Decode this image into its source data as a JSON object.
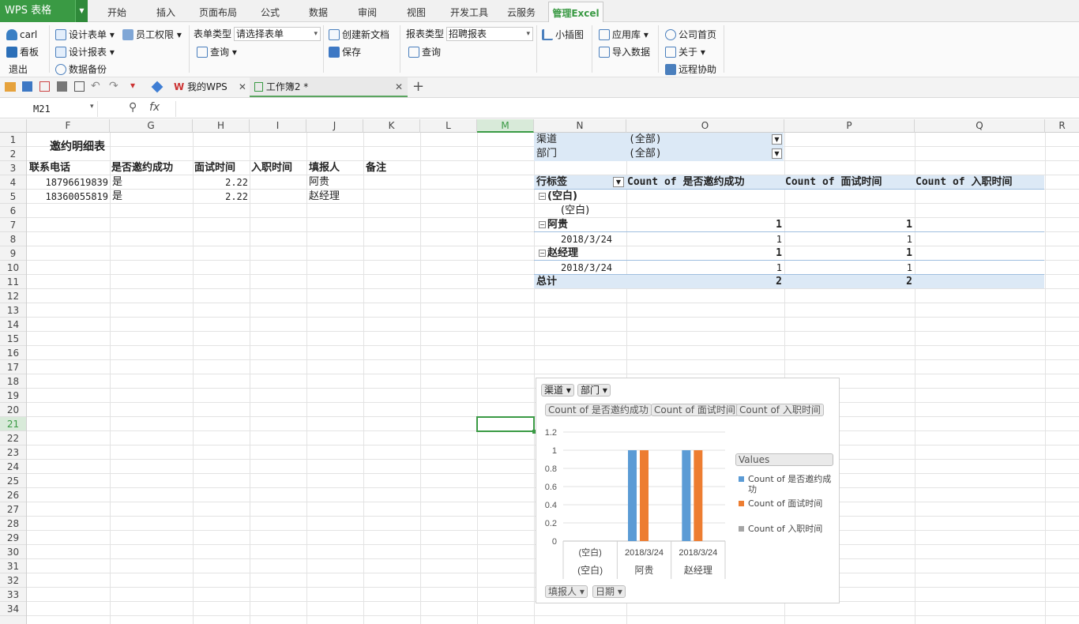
{
  "app": {
    "logo": "WPS 表格",
    "tabs": [
      "开始",
      "插入",
      "页面布局",
      "公式",
      "数据",
      "审阅",
      "视图",
      "开发工具",
      "云服务",
      "管理Excel"
    ]
  },
  "ribbon": {
    "user": "carl",
    "board": "看板",
    "logout": "退出",
    "design_form": "设计表单",
    "staff_perm": "员工权限",
    "form_type_label": "表单类型",
    "form_type_value": "请选择表单",
    "query1": "查询",
    "new_doc": "创建新文档",
    "save": "保存",
    "design_report": "设计报表",
    "backup": "数据备份",
    "report_type_label": "报表类型",
    "report_type_value": "招聘报表",
    "query2": "查询",
    "mini_chart": "小插图",
    "app_store": "应用库",
    "import_data": "导入数据",
    "home": "公司首页",
    "about": "关于",
    "remote": "远程协助"
  },
  "doctabs": {
    "mywps": "我的WPS",
    "workbook": "工作簿2 *"
  },
  "formula": {
    "name_box": "M21",
    "fx": "fx"
  },
  "columns": [
    "F",
    "G",
    "H",
    "I",
    "J",
    "K",
    "L",
    "M",
    "N",
    "O",
    "P",
    "Q",
    "R"
  ],
  "rows": [
    "1",
    "2",
    "3",
    "4",
    "5",
    "6",
    "7",
    "8",
    "9",
    "10",
    "11",
    "12",
    "13",
    "14",
    "15",
    "16",
    "17",
    "18",
    "19",
    "20",
    "21",
    "22",
    "23",
    "24",
    "25",
    "26",
    "27",
    "28",
    "29",
    "30",
    "31",
    "32",
    "33",
    "34"
  ],
  "sheet": {
    "title": "邀约明细表",
    "headers": [
      "联系电话",
      "是否邀约成功",
      "面试时间",
      "入职时间",
      "填报人",
      "备注"
    ],
    "data": [
      [
        "18796619839",
        "是",
        "2.22",
        "",
        "阿贵",
        ""
      ],
      [
        "18360055819",
        "是",
        "2.22",
        "",
        "赵经理",
        ""
      ]
    ]
  },
  "pivot": {
    "filter1_label": "渠道",
    "filter1_value": "(全部)",
    "filter2_label": "部门",
    "filter2_value": "(全部)",
    "row_label": "行标签",
    "col1": "Count of 是否邀约成功",
    "col2": "Count of 面试时间",
    "col3": "Count of 入职时间",
    "g1": "(空白)",
    "g1_sub": "(空白)",
    "g2": "阿贵",
    "g2_v1": "1",
    "g2_v2": "1",
    "g2_sub": "2018/3/24",
    "g2_sub_v1": "1",
    "g2_sub_v2": "1",
    "g3": "赵经理",
    "g3_v1": "1",
    "g3_v2": "1",
    "g3_sub": "2018/3/24",
    "g3_sub_v1": "1",
    "g3_sub_v2": "1",
    "total": "总计",
    "total_v1": "2",
    "total_v2": "2"
  },
  "chart_data": {
    "type": "bar",
    "filters": [
      "渠道",
      "部门"
    ],
    "value_buttons": [
      "Count of 是否邀约成功",
      "Count of 面试时间",
      "Count of 入职时间"
    ],
    "legend_title": "Values",
    "categories": [
      [
        "(空白)",
        "(空白)"
      ],
      [
        "2018/3/24",
        "阿贵"
      ],
      [
        "2018/3/24",
        "赵经理"
      ]
    ],
    "series": [
      {
        "name": "Count of 是否邀约成功",
        "color": "#5b9bd5",
        "values": [
          0,
          1,
          1
        ]
      },
      {
        "name": "Count of 面试时间",
        "color": "#ed7d31",
        "values": [
          0,
          1,
          1
        ]
      },
      {
        "name": "Count of 入职时间",
        "color": "#a5a5a5",
        "values": [
          0,
          0,
          0
        ]
      }
    ],
    "yticks": [
      "0",
      "0.2",
      "0.4",
      "0.6",
      "0.8",
      "1",
      "1.2"
    ],
    "ylim": [
      0,
      1.2
    ],
    "axis_buttons": [
      "填报人",
      "日期"
    ]
  },
  "colors": {
    "accent": "#3a9a44",
    "pivot_band": "#dce9f6"
  }
}
